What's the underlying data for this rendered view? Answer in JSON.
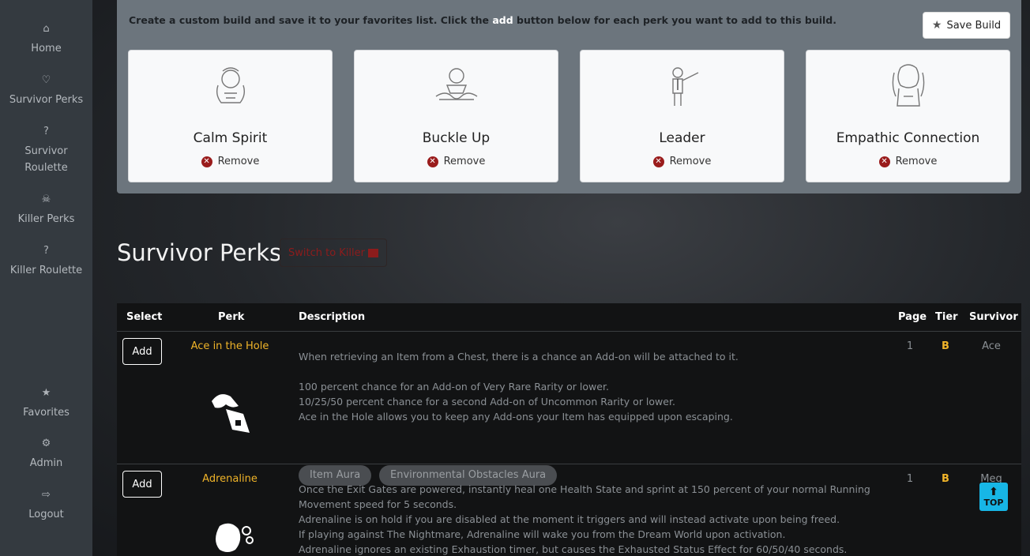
{
  "sidebar": {
    "items": [
      {
        "label": "Home",
        "icon": "home-icon",
        "glyph": "⌂"
      },
      {
        "label": "Survivor Perks",
        "icon": "heart-pulse-icon",
        "glyph": "♡"
      },
      {
        "label": "Survivor Roulette",
        "icon": "question-icon",
        "glyph": "?"
      },
      {
        "label": "Killer Perks",
        "icon": "skull-icon",
        "glyph": "☠"
      },
      {
        "label": "Killer Roulette",
        "icon": "question-icon",
        "glyph": "?"
      },
      {
        "label": "Favorites",
        "icon": "star-icon",
        "glyph": "★"
      },
      {
        "label": "Admin",
        "icon": "gear-icon",
        "glyph": "⚙"
      },
      {
        "label": "Logout",
        "icon": "logout-icon",
        "glyph": "⇨"
      }
    ]
  },
  "build": {
    "instruction_before": "Create a custom build and save it to your favorites list. Click the ",
    "instruction_add": "add",
    "instruction_after": " button below for each perk you want to add to this build.",
    "save_label": "Save Build",
    "remove_label": "Remove",
    "perks": [
      {
        "name": "Calm Spirit",
        "icon": "calm-spirit-icon"
      },
      {
        "name": "Buckle Up",
        "icon": "buckle-up-icon"
      },
      {
        "name": "Leader",
        "icon": "leader-icon"
      },
      {
        "name": "Empathic Connection",
        "icon": "empathic-connection-icon"
      }
    ]
  },
  "section": {
    "title": "Survivor Perks",
    "switch_label": "Switch to Killer"
  },
  "table": {
    "headers": [
      "Select",
      "Perk",
      "Description",
      "Page",
      "Tier",
      "Survivor"
    ],
    "add_label": "Add",
    "rows": [
      {
        "perk": "Ace in the Hole",
        "icon": "ace-in-the-hole-icon",
        "description": [
          "When retrieving an Item from a Chest, there is a chance an Add-on will be attached to it.",
          "",
          "100 percent chance for an Add-on of Very Rare Rarity or lower.",
          "10/25/50 percent chance for a second Add-on of Uncommon Rarity or lower.",
          "Ace in the Hole allows you to keep any Add-ons your Item has equipped upon escaping."
        ],
        "page": "1",
        "tier": "B",
        "survivor": "Ace",
        "tags": [
          "Item Aura",
          "Environmental Obstacles Aura"
        ]
      },
      {
        "perk": "Adrenaline",
        "icon": "adrenaline-icon",
        "description": [
          "Once the Exit Gates are powered, instantly heal one Health State and sprint at 150 percent of your normal Running",
          "Movement speed for 5 seconds.",
          "Adrenaline is on hold if you are disabled at the moment it triggers and will instead activate upon being freed.",
          "If playing against The Nightmare, Adrenaline will wake you from the Dream World upon activation.",
          "Adrenaline ignores an existing Exhaustion timer, but causes the Exhausted Status Effect for 60/50/40 seconds."
        ],
        "page": "1",
        "tier": "B",
        "survivor": "Meg"
      }
    ]
  },
  "top_button": {
    "label": "TOP",
    "icon": "arrow-up-icon"
  }
}
